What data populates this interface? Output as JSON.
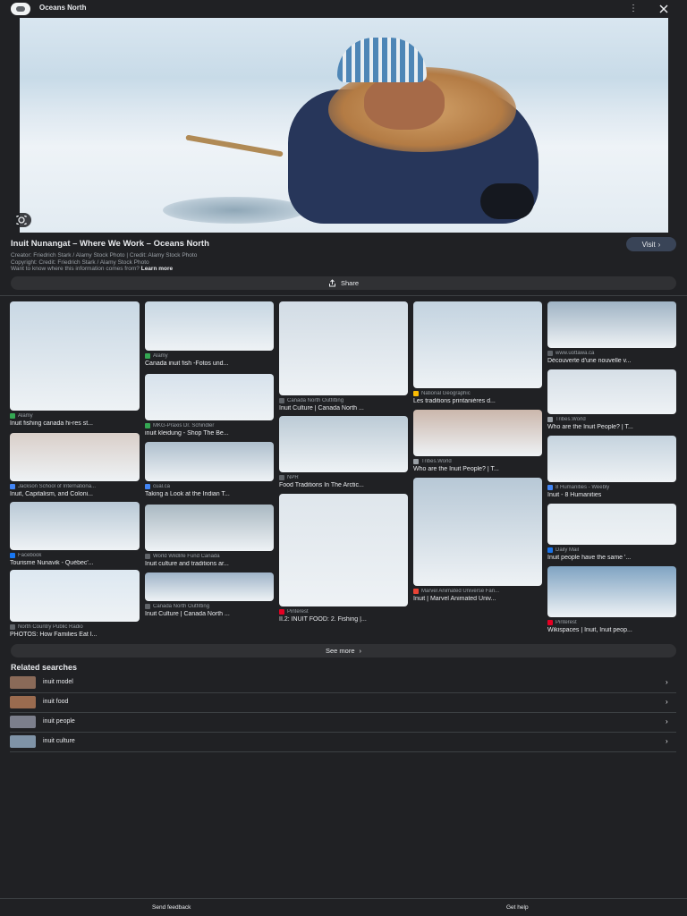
{
  "header": {
    "site_name": "Oceans North",
    "favicon": "site-favicon",
    "more_icon": "more-vertical-icon",
    "close_icon": "close-icon"
  },
  "hero": {
    "alt": "lens-icon"
  },
  "info": {
    "title": "Inuit Nunangat – Where We Work – Oceans North",
    "visit_label": "Visit",
    "creator": "Creator: Friedrich Stark / Alamy Stock Photo | Credit: Alamy Stock Photo",
    "copyright": "Copyright: Credit: Friedrich Stark / Alamy Stock Photo",
    "info_prefix": "Want to know where this information comes from?",
    "learn_more": "Learn more",
    "share_label": "Share"
  },
  "results": [
    {
      "source": "Alamy",
      "caption": "Inuit fishing canada hi-res st...",
      "color": "#34a853",
      "thumb": "#c9d8e4"
    },
    {
      "source": "Jackson School of Internationa...",
      "caption": "Inuit, Capitalism, and Coloni...",
      "color": "#4285f4",
      "thumb": "#d9cfc9"
    },
    {
      "source": "Facebook",
      "caption": "Tourisme Nunavik - Québec'...",
      "color": "#1877f2",
      "thumb": "#b9c9d6"
    },
    {
      "source": "North Country Public Radio",
      "caption": "PHOTOS: How Families Eat I...",
      "color": "#5f6368",
      "thumb": "#dde8f1"
    },
    {
      "source": "Alamy",
      "caption": "Canada inuit fish -Fotos und...",
      "color": "#34a853",
      "thumb": "#c7d6e2"
    },
    {
      "source": "MKG-Praxis Dr. Schindler",
      "caption": "inuit kleidung - Shop The Be...",
      "color": "#34a853",
      "thumb": "#d7e2ec"
    },
    {
      "source": "cual.ca",
      "caption": "Taking a Look at the Indian T...",
      "color": "#4285f4",
      "thumb": "#aebfcd"
    },
    {
      "source": "World Wildlife Fund Canada",
      "caption": "Inuit culture and traditions ar...",
      "color": "#5f6368",
      "thumb": "#a9b8c2"
    },
    {
      "source": "Canada North Outfitting",
      "caption": "Inuit Culture | Canada North ...",
      "color": "#5f6368",
      "thumb": "#9fb4c8"
    },
    {
      "source": "Canada North Outfitting",
      "caption": "Inuit Culture | Canada North ...",
      "color": "#5f6368",
      "thumb": "#d2dce5"
    },
    {
      "source": "NPR",
      "caption": "Food Traditions In The Arctic...",
      "color": "#5f6368",
      "thumb": "#bccbd6"
    },
    {
      "source": "Pinterest",
      "caption": "II.2: INUIT FOOD: 2. Fishing |...",
      "color": "#e60023",
      "thumb": "#dfe6ec"
    },
    {
      "source": "National Geographic",
      "caption": "Les traditions printanières d...",
      "color": "#fbbc04",
      "thumb": "#c3d3e0"
    },
    {
      "source": "Tribes.World",
      "caption": "Who are the Inuit People? | T...",
      "color": "#9aa0a6",
      "thumb": "#cbb7ac"
    },
    {
      "source": "Marvel Animated Universe Fan...",
      "caption": "Inuit | Marvel Animated Univ...",
      "color": "#ea4335",
      "thumb": "#b7c8d6"
    },
    {
      "source": "www.uottawa.ca",
      "caption": "Découverte d'une nouvelle v...",
      "color": "#5f6368",
      "thumb": "#9fb3c4"
    },
    {
      "source": "Tribes.World",
      "caption": "Who are the Inuit People? | T...",
      "color": "#9aa0a6",
      "thumb": "#d6dfe7"
    },
    {
      "source": "8 Humanities - Weebly",
      "caption": "Inuit - 8 Humanities",
      "color": "#4285f4",
      "thumb": "#c5d3de"
    },
    {
      "source": "Daily Mail",
      "caption": "Inuit people have the same '...",
      "color": "#1a73e8",
      "thumb": "#e2e9ee"
    },
    {
      "source": "Pinterest",
      "caption": "Wikispaces | Inuit, Inuit peop...",
      "color": "#e60023",
      "thumb": "#7fa3c2"
    }
  ],
  "see_more_label": "See more",
  "related": {
    "title": "Related searches",
    "items": [
      {
        "label": "inuit model",
        "thumb": "#8a6a58"
      },
      {
        "label": "inuit food",
        "thumb": "#9a6b4f"
      },
      {
        "label": "inuit people",
        "thumb": "#7c7f8c"
      },
      {
        "label": "inuit culture",
        "thumb": "#7f93a7"
      }
    ]
  },
  "footer": {
    "feedback_label": "Send feedback",
    "help_label": "Get help"
  }
}
